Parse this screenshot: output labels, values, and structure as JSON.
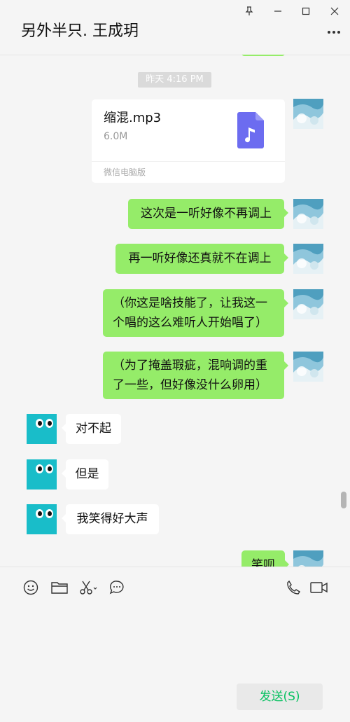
{
  "header": {
    "title": "另外半只. 王成玥",
    "pin_icon": "pin-icon",
    "minimize_icon": "minimize-icon",
    "maximize_icon": "maximize-icon",
    "close_icon": "close-icon",
    "more_icon": "more-dots-icon"
  },
  "messages": {
    "timestamp": "昨天 4:16 PM",
    "file": {
      "name": "缩混.mp3",
      "size": "6.0M",
      "source": "微信电脑版",
      "icon": "music-file-icon"
    },
    "sent": [
      "这次是一听好像不再调上",
      "再一听好像还真就不在调上",
      "（你这是啥技能了，让我这一个唱的这么难听人开始唱了）",
      "（为了掩盖瑕疵，混响调的重了一些，但好像没什么卵用）"
    ],
    "received": [
      "对不起",
      "但是",
      "我笑得好大声"
    ],
    "last_sent_partial": "笑呗"
  },
  "toolbar": {
    "emoji_icon": "emoji-icon",
    "folder_icon": "folder-icon",
    "scissors_icon": "scissors-icon",
    "chat_icon": "chat-bubble-icon",
    "phone_icon": "phone-icon",
    "video_icon": "video-call-icon"
  },
  "send_label": "发送(S)",
  "colors": {
    "sent_bubble": "#95ec69",
    "received_bubble": "#ffffff",
    "send_text": "#07c160",
    "avatar_cyan": "#19bdc9"
  }
}
